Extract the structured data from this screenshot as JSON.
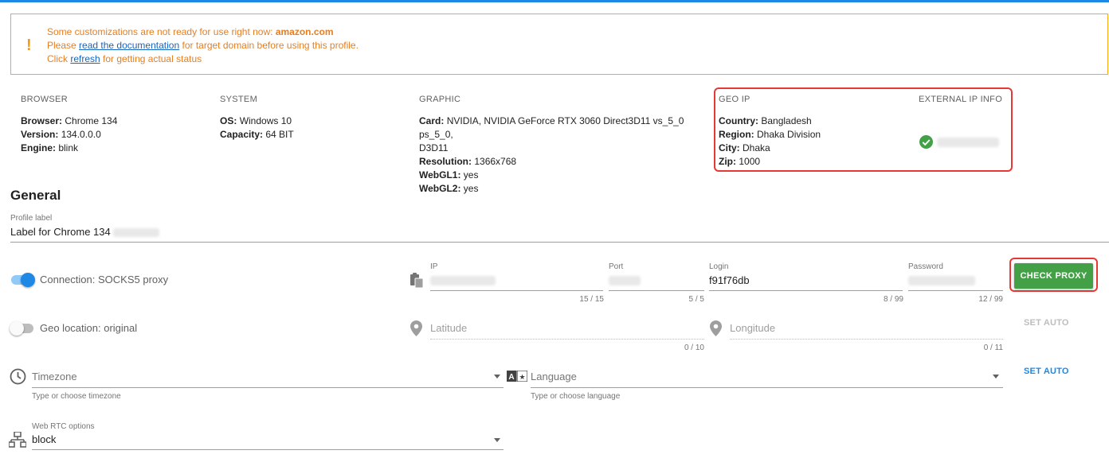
{
  "warning": {
    "line1_prefix": "Some customizations are not ready for use right now:",
    "line1_domain": "amazon.com",
    "line2_prefix": "Please",
    "line2_link": "read the documentation",
    "line2_suffix": "for target domain before using this profile.",
    "line3_prefix": "Click",
    "line3_link": "refresh",
    "line3_suffix": "for getting actual status",
    "icon": "exclamation-icon"
  },
  "browser": {
    "header": "BROWSER",
    "browser_label": "Browser:",
    "browser_value": "Chrome 134",
    "version_label": "Version:",
    "version_value": "134.0.0.0",
    "engine_label": "Engine:",
    "engine_value": "blink"
  },
  "system": {
    "header": "SYSTEM",
    "os_label": "OS:",
    "os_value": "Windows 10",
    "capacity_label": "Capacity:",
    "capacity_value": "64 BIT"
  },
  "graphic": {
    "header": "GRAPHIC",
    "card_label": "Card:",
    "card_value": "NVIDIA, NVIDIA GeForce RTX 3060 Direct3D11 vs_5_0 ps_5_0,",
    "card_value2": "D3D11",
    "resolution_label": "Resolution:",
    "resolution_value": "1366x768",
    "webgl1_label": "WebGL1:",
    "webgl1_value": "yes",
    "webgl2_label": "WebGL2:",
    "webgl2_value": "yes"
  },
  "geo_ip": {
    "header": "GEO IP",
    "country_label": "Country:",
    "country_value": "Bangladesh",
    "region_label": "Region:",
    "region_value": "Dhaka Division",
    "city_label": "City:",
    "city_value": "Dhaka",
    "zip_label": "Zip:",
    "zip_value": "1000"
  },
  "external_ip": {
    "header": "EXTERNAL IP INFO",
    "status_icon": "check-circle-icon"
  },
  "general": {
    "title": "General",
    "profile_label_caption": "Profile label",
    "profile_label_value": "Label for Chrome 134"
  },
  "connection": {
    "toggle_label": "Connection: SOCKS5 proxy",
    "toggle_on": true,
    "ip_caption": "IP",
    "ip_counter": "15 / 15",
    "port_caption": "Port",
    "port_counter": "5 / 5",
    "login_caption": "Login",
    "login_value": "f91f76db",
    "login_counter": "8 / 99",
    "password_caption": "Password",
    "password_counter": "12 / 99",
    "check_button": "CHECK PROXY"
  },
  "geo_location": {
    "toggle_label": "Geo location: original",
    "toggle_on": false,
    "latitude_placeholder": "Latitude",
    "latitude_counter": "0 / 10",
    "longitude_placeholder": "Longitude",
    "longitude_counter": "0 / 11",
    "set_auto": "SET AUTO"
  },
  "timezone": {
    "placeholder": "Timezone",
    "hint": "Type or choose timezone"
  },
  "language": {
    "placeholder": "Language",
    "hint": "Type or choose language",
    "set_auto": "SET AUTO"
  },
  "webrtc": {
    "caption": "Web RTC options",
    "value": "block"
  },
  "colors": {
    "accent": "#1e88e5",
    "warning": "#e67e22",
    "success": "#43a047",
    "highlight": "#e53935"
  }
}
